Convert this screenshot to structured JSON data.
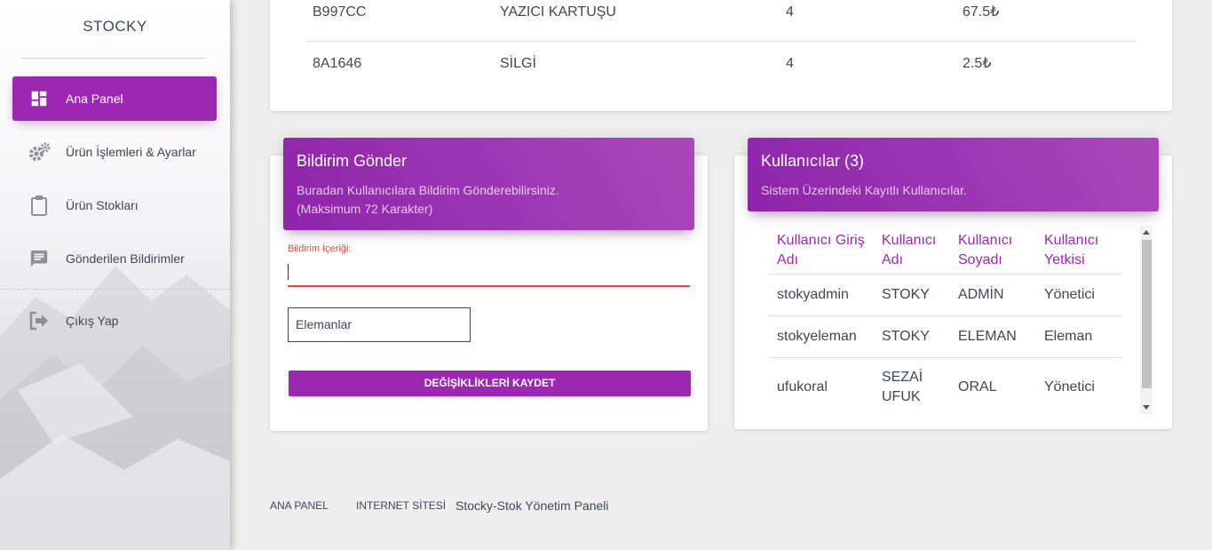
{
  "sidebar": {
    "brand": "STOCKY",
    "items": [
      {
        "label": "Ana Panel",
        "icon": "dashboard-icon",
        "active": true
      },
      {
        "label": "Ürün İşlemleri & Ayarlar",
        "icon": "gears-icon"
      },
      {
        "label": "Ürün Stokları",
        "icon": "clipboard-icon"
      },
      {
        "label": "Gönderilen Bildirimler",
        "icon": "message-icon"
      },
      {
        "label": "Çıkış Yap",
        "icon": "logout-icon"
      }
    ]
  },
  "products": {
    "rows": [
      {
        "code": "B997CC",
        "name": "YAZICI KARTUŞU",
        "qty": "4",
        "price": "67.5₺"
      },
      {
        "code": "8A1646",
        "name": "SİLGİ",
        "qty": "4",
        "price": "2.5₺"
      }
    ]
  },
  "notification": {
    "title": "Bildirim Gönder",
    "subtitle_line1": "Buradan Kullanıcılara Bildirim Gönderebilirsiniz.",
    "subtitle_line2": "(Maksimum 72 Karakter)",
    "content_label": "Bildirim İçeriği:",
    "content_value": "",
    "select_value": "Elemanlar",
    "save_label": "DEĞİŞİKLİKLERİ KAYDET"
  },
  "users": {
    "title": "Kullanıcılar (3)",
    "subtitle": "Sistem Üzerindeki Kayıtlı Kullanıcılar.",
    "headers": [
      [
        "Kullanıcı Giriş",
        "Adı"
      ],
      [
        "Kullanıcı",
        "Adı"
      ],
      [
        "Kullanıcı",
        "Soyadı"
      ],
      [
        "Kullanıcı",
        "Yetkisi"
      ]
    ],
    "rows": [
      {
        "login": "stokyadmin",
        "name1": "STOKY",
        "name2": "",
        "surname": "ADMİN",
        "role": "Yönetici"
      },
      {
        "login": "stokyeleman",
        "name1": "STOKY",
        "name2": "",
        "surname": "ELEMAN",
        "role": "Eleman"
      },
      {
        "login": "ufukoral",
        "name1": "SEZAİ",
        "name2": "UFUK",
        "surname": "ORAL",
        "role": "Yönetici"
      }
    ]
  },
  "footer": {
    "link1": "ANA PANEL",
    "link2": "INTERNET SİTESİ",
    "copyright": "Stocky-Stok Yönetim Paneli"
  },
  "colors": {
    "accent": "#9c27b0",
    "error": "#f44336",
    "background": "#eeeeee"
  }
}
